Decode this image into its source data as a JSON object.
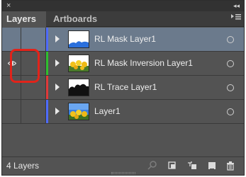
{
  "panel": {
    "close_glyph": "×",
    "collapse_glyph": "◂◂",
    "menu_icon": "panel-menu-icon"
  },
  "tabs": [
    {
      "label": "Layers"
    },
    {
      "label": "Artboards"
    }
  ],
  "layers": [
    {
      "name": "RL Mask Layer1",
      "color": "#4f6cff",
      "visible": false,
      "selected": true
    },
    {
      "name": "RL Mask Inversion Layer1",
      "color": "#2fbf2f",
      "visible": true,
      "selected": false
    },
    {
      "name": "RL Trace Layer1",
      "color": "#e03a3a",
      "visible": false,
      "selected": false
    },
    {
      "name": "Layer1",
      "color": "#4f6cff",
      "visible": false,
      "selected": false
    }
  ],
  "footer": {
    "count_label": "4 Layers",
    "buttons": [
      "search-icon",
      "collect-for-export-icon",
      "make-clipping-mask-icon",
      "new-sublayer-icon",
      "new-layer-icon",
      "delete-icon"
    ]
  },
  "colors": {
    "panel_bg": "#535353",
    "selected_row": "#6b7a8c",
    "highlight": "#e2231a"
  }
}
